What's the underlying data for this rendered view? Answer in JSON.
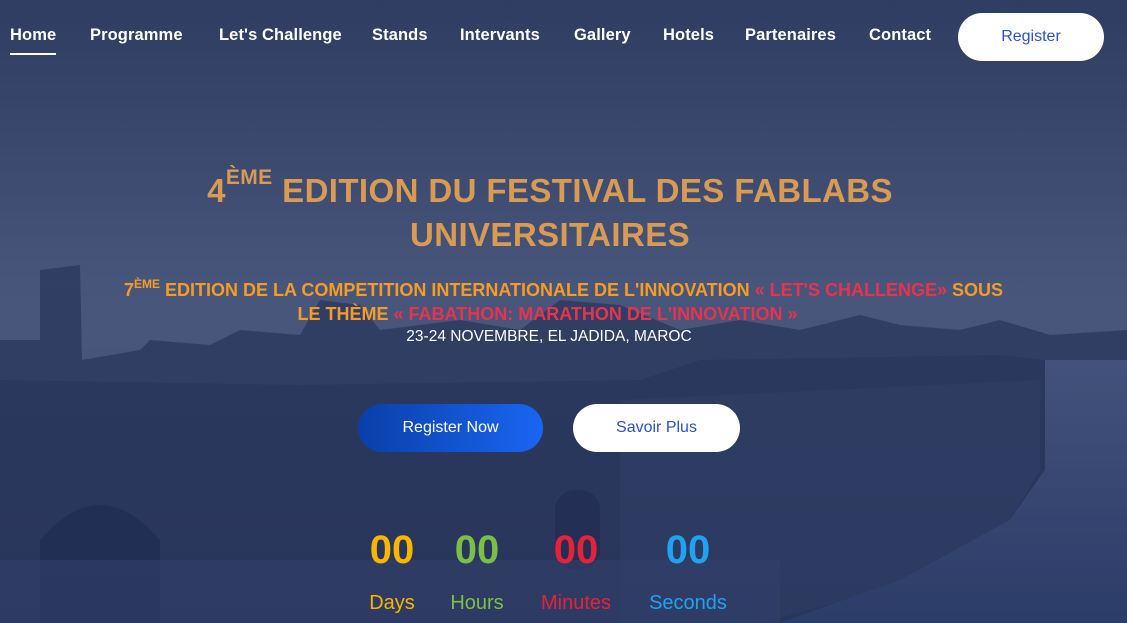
{
  "nav": {
    "items": [
      {
        "label": "Home",
        "active": true
      },
      {
        "label": "Programme"
      },
      {
        "label": "Let's Challenge"
      },
      {
        "label": "Stands"
      },
      {
        "label": "Intervants"
      },
      {
        "label": "Gallery"
      },
      {
        "label": "Hotels"
      },
      {
        "label": "Partenaires"
      },
      {
        "label": "Contact"
      }
    ],
    "register_label": "Register"
  },
  "hero": {
    "title_num": "4",
    "title_sup": "ÈME",
    "title_line1_rest": " EDITION DU FESTIVAL DES FABLABS",
    "title_line2": "UNIVERSITAIRES",
    "sub_num": "7",
    "sub_sup": "ÈME",
    "sub_line1_a": " EDITION DE LA COMPETITION INTERNATIONALE DE L'INNOVATION ",
    "sub_line1_red": "« LET'S CHALLENGE»",
    "sub_line1_b": " SOUS",
    "sub_line2_a": "LE THÈME ",
    "sub_line2_red": "« FABATHON: MARATHON DE L'INNOVATION »",
    "date": "23-24 NOVEMBRE, EL JADIDA, MAROC",
    "cta_primary": "Register Now",
    "cta_secondary": "Savoir Plus"
  },
  "countdown": {
    "days": "00",
    "days_label": "Days",
    "hours": "00",
    "hours_label": "Hours",
    "minutes": "00",
    "minutes_label": "Minutes",
    "seconds": "00",
    "seconds_label": "Seconds"
  },
  "colors": {
    "title_gold": "#d99b52",
    "subtitle_orange": "#f39c27",
    "accent_red": "#e8334f",
    "days_yellow": "#f8b600",
    "hours_green": "#7bbf47",
    "minutes_red": "#e8213b",
    "seconds_blue": "#1fa3f0",
    "button_blue": "#1a66f2"
  }
}
